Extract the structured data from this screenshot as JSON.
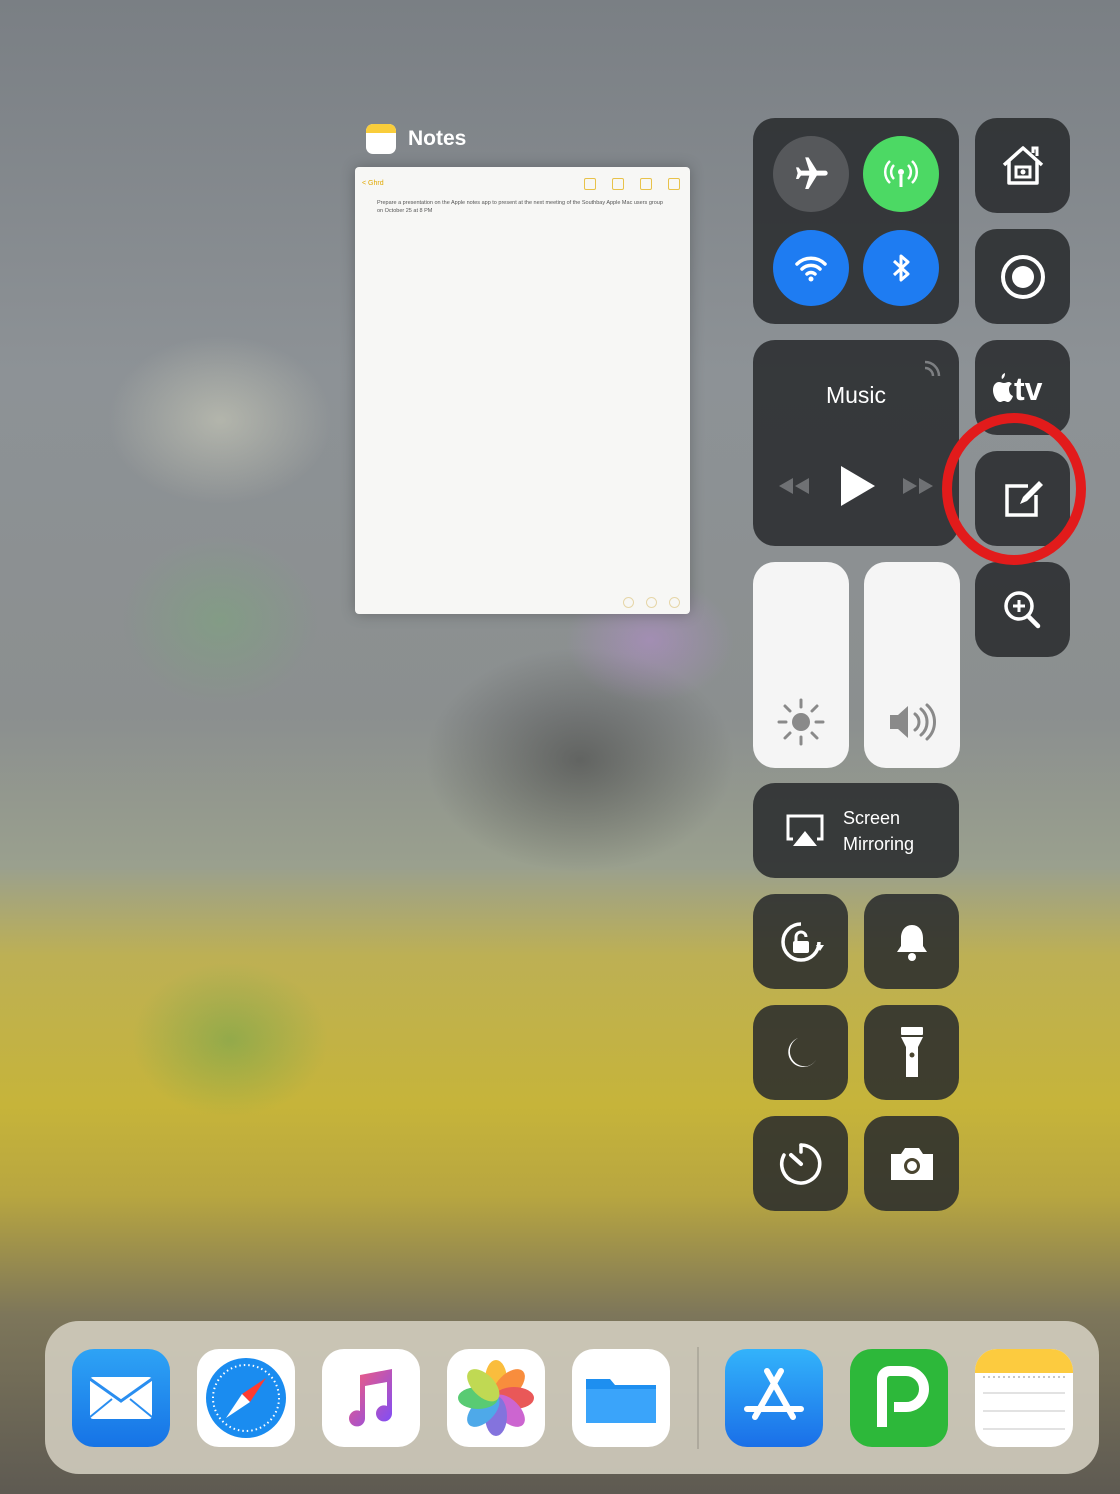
{
  "app_switcher": {
    "app_label": "Notes",
    "note_back_label": "< Ghrd",
    "note_text": "Prepare a presentation on the Apple notes app to present at the next meeting of the Southbay Apple Mac users group on October 25 at 8 PM"
  },
  "control_center": {
    "connectivity": {
      "airplane_mode": "off",
      "cellular_data": "on",
      "wifi": "on",
      "bluetooth": "on"
    },
    "music": {
      "title": "Music"
    },
    "shortcuts": {
      "home": "home-icon",
      "screen_recording": "screen-record-icon",
      "apple_tv": "apple-tv-icon",
      "apple_tv_text": "tv",
      "notes": "notes-compose-icon",
      "magnifier": "magnifier-icon"
    },
    "sliders": {
      "brightness": 1.0,
      "volume": 1.0
    },
    "screen_mirroring": {
      "line1": "Screen",
      "line2": "Mirroring"
    },
    "toggles": [
      "orientation-lock-icon",
      "bell-icon",
      "moon-icon",
      "flashlight-icon",
      "timer-icon",
      "camera-icon"
    ]
  },
  "dock": {
    "apps": [
      "mail-icon",
      "safari-icon",
      "music-icon",
      "photos-icon",
      "files-icon",
      "app-store-icon",
      "green-p-app-icon",
      "notes-icon"
    ]
  },
  "colors": {
    "connect_green": "#4cd964",
    "connect_blue": "#1e7cf2",
    "highlight_red": "#e21b1b"
  }
}
